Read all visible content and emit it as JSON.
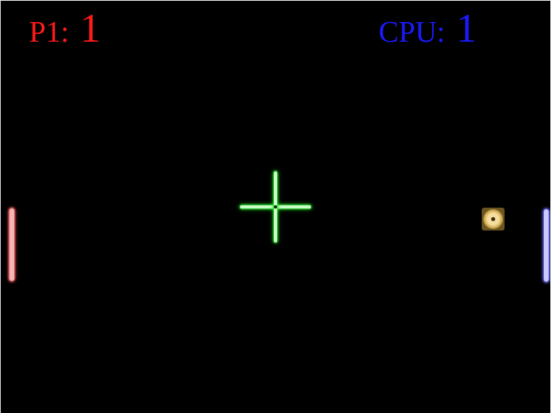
{
  "scoreboard": {
    "player": {
      "label": "P1:",
      "score": "1",
      "color": "#ff1a1a"
    },
    "cpu": {
      "label": "CPU:",
      "score": "1",
      "color": "#1a1aff"
    }
  },
  "paddles": {
    "player_color": "#ff6d6d",
    "cpu_color": "#6e6eff"
  },
  "crosshair": {
    "icon": "crosshair-icon",
    "color": "#2ee62e"
  },
  "ball": {
    "icon": "ball-icon",
    "color": "#e8c878"
  },
  "background": "#000000"
}
